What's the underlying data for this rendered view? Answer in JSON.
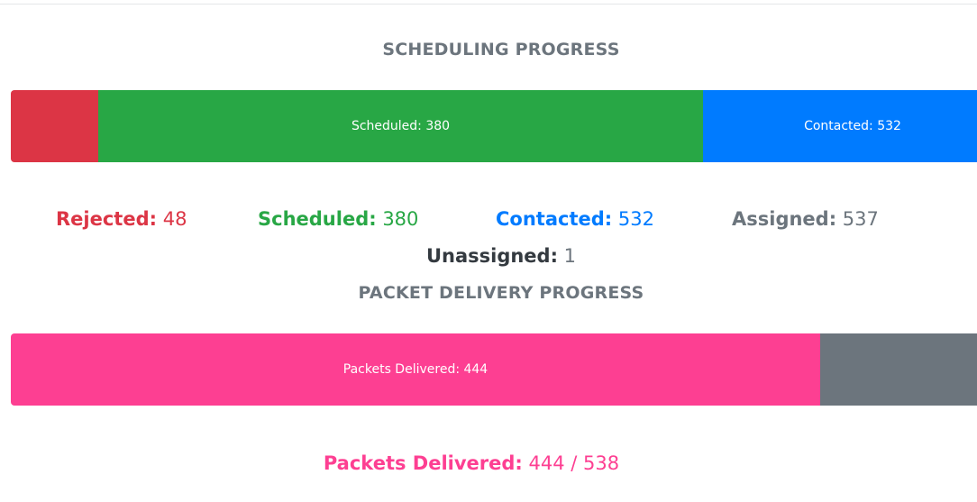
{
  "colors": {
    "rejected": "#dc3545",
    "scheduled": "#28a745",
    "contacted": "#007bff",
    "assigned": "#6c757d",
    "unassigned": "#343a40",
    "packets": "#fd3f92",
    "remaining": "#6c757d"
  },
  "scheduling": {
    "title": "SCHEDULING PROGRESS",
    "bar": {
      "rejected_value": 48,
      "scheduled_label": "Scheduled: 380",
      "scheduled_value": 380,
      "contacted_label": "Contacted: 532",
      "contacted_value": 532
    },
    "stats": {
      "rejected_label": "Rejected:",
      "rejected_value": "48",
      "scheduled_label": "Scheduled:",
      "scheduled_value": "380",
      "contacted_label": "Contacted:",
      "contacted_value": "532",
      "assigned_label": "Assigned:",
      "assigned_value": "537",
      "unassigned_label": "Unassigned:",
      "unassigned_value": "1"
    }
  },
  "packets": {
    "title": "PACKET DELIVERY PROGRESS",
    "bar": {
      "delivered_label": "Packets Delivered: 444",
      "delivered_value": 444,
      "total": 538
    },
    "stats": {
      "delivered_label": "Packets Delivered:",
      "delivered_value": "444 / 538"
    }
  }
}
